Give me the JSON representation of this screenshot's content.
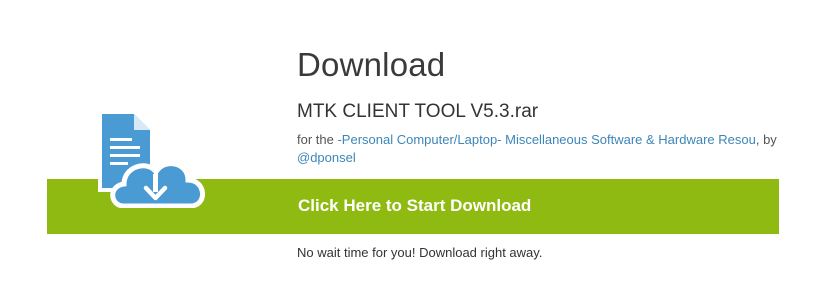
{
  "download_section": {
    "heading": "Download",
    "file_name": "MTK CLIENT TOOL V5.3.rar",
    "meta_prefix": "for the ",
    "category_link": "-Personal Computer/Laptop- Miscellaneous Software & Hardware Resou",
    "meta_by": ", by ",
    "author_link": "@dponsel",
    "download_button_label": "Click Here to Start Download",
    "note": "No wait time for you! Download right away."
  },
  "colors": {
    "download_bar": "#8fba12",
    "icon_blue": "#4a9ad4",
    "link": "#3d86b8"
  },
  "icons": {
    "file_download": "file-cloud-download-icon"
  }
}
